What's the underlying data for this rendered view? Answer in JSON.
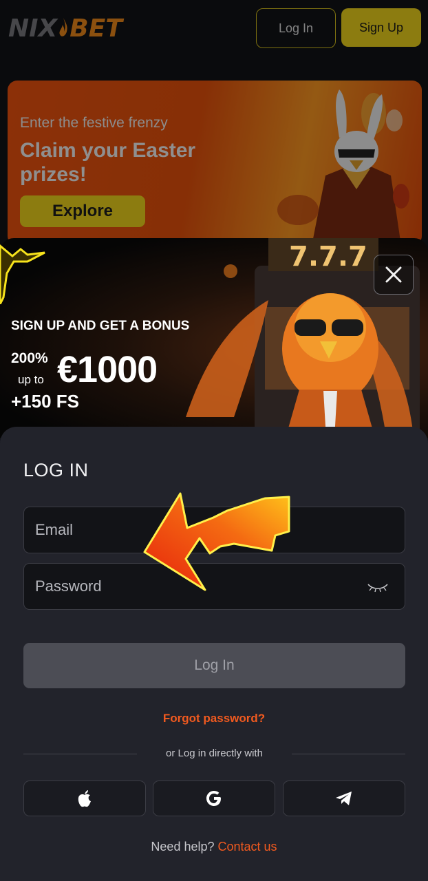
{
  "header": {
    "logo_part1": "NIX",
    "logo_part2": "BET",
    "login_label": "Log In",
    "signup_label": "Sign Up"
  },
  "promo": {
    "subtitle": "Enter the festive frenzy",
    "title": "Claim your Easter prizes!",
    "button_label": "Explore"
  },
  "bonus": {
    "heading": "SIGN UP AND GET A BONUS",
    "percent": "200%",
    "up_to": "up to",
    "amount": "€1000",
    "free_spins": "+150 FS",
    "close_icon": "close-icon"
  },
  "login": {
    "title": "LOG IN",
    "email_placeholder": "Email",
    "password_placeholder": "Password",
    "submit_label": "Log In",
    "forgot_label": "Forgot password?",
    "divider_text": "or Log in directly with",
    "social": [
      {
        "icon": "apple-icon"
      },
      {
        "icon": "google-icon"
      },
      {
        "icon": "telegram-icon"
      }
    ],
    "help_text": "Need help?",
    "contact_label": "Contact us"
  },
  "colors": {
    "accent_yellow": "#f2d61c",
    "accent_orange": "#f25a1f",
    "panel_bg": "#22232b",
    "page_bg": "#121317"
  }
}
